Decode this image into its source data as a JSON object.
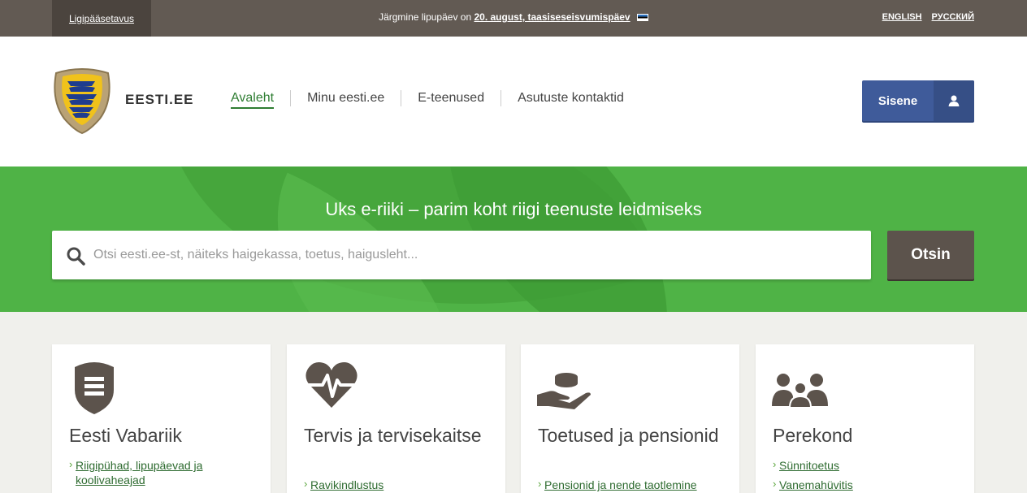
{
  "topbar": {
    "accessibility": "Ligipääsetavus",
    "flag_text": "Järgmine lipupäev on",
    "flag_date": "20. august, taasiseseisvumispäev",
    "languages": [
      "ENGLISH",
      "РУССКИЙ"
    ]
  },
  "header": {
    "brand": "EESTI.EE",
    "nav": [
      "Avaleht",
      "Minu eesti.ee",
      "E-teenused",
      "Asutuste kontaktid"
    ],
    "login": "Sisene"
  },
  "hero": {
    "title": "Uks e-riiki – parim koht riigi teenuste leidmiseks",
    "search_placeholder": "Otsi eesti.ee-st, näiteks haigekassa, toetus, haigusleht...",
    "search_button": "Otsin"
  },
  "cards": [
    {
      "title": "Eesti Vabariik",
      "icon": "shield-icon",
      "links": [
        "Riigipühad, lipupäevad ja koolivaheajad"
      ]
    },
    {
      "title": "Tervis ja tervisekaitse",
      "icon": "heart-pulse-icon",
      "links": [
        "Ravikindlustus"
      ]
    },
    {
      "title": "Toetused ja pensionid",
      "icon": "hand-coins-icon",
      "links": [
        "Pensionid ja nende taotlemine"
      ]
    },
    {
      "title": "Perekond",
      "icon": "family-icon",
      "links": [
        "Sünnitoetus",
        "Vanemahüvitis"
      ]
    }
  ],
  "colors": {
    "topbar": "#625a53",
    "hero": "#4fb346",
    "login": "#3f5b9a",
    "search_button": "#5c534c",
    "link": "#2e6b30"
  }
}
